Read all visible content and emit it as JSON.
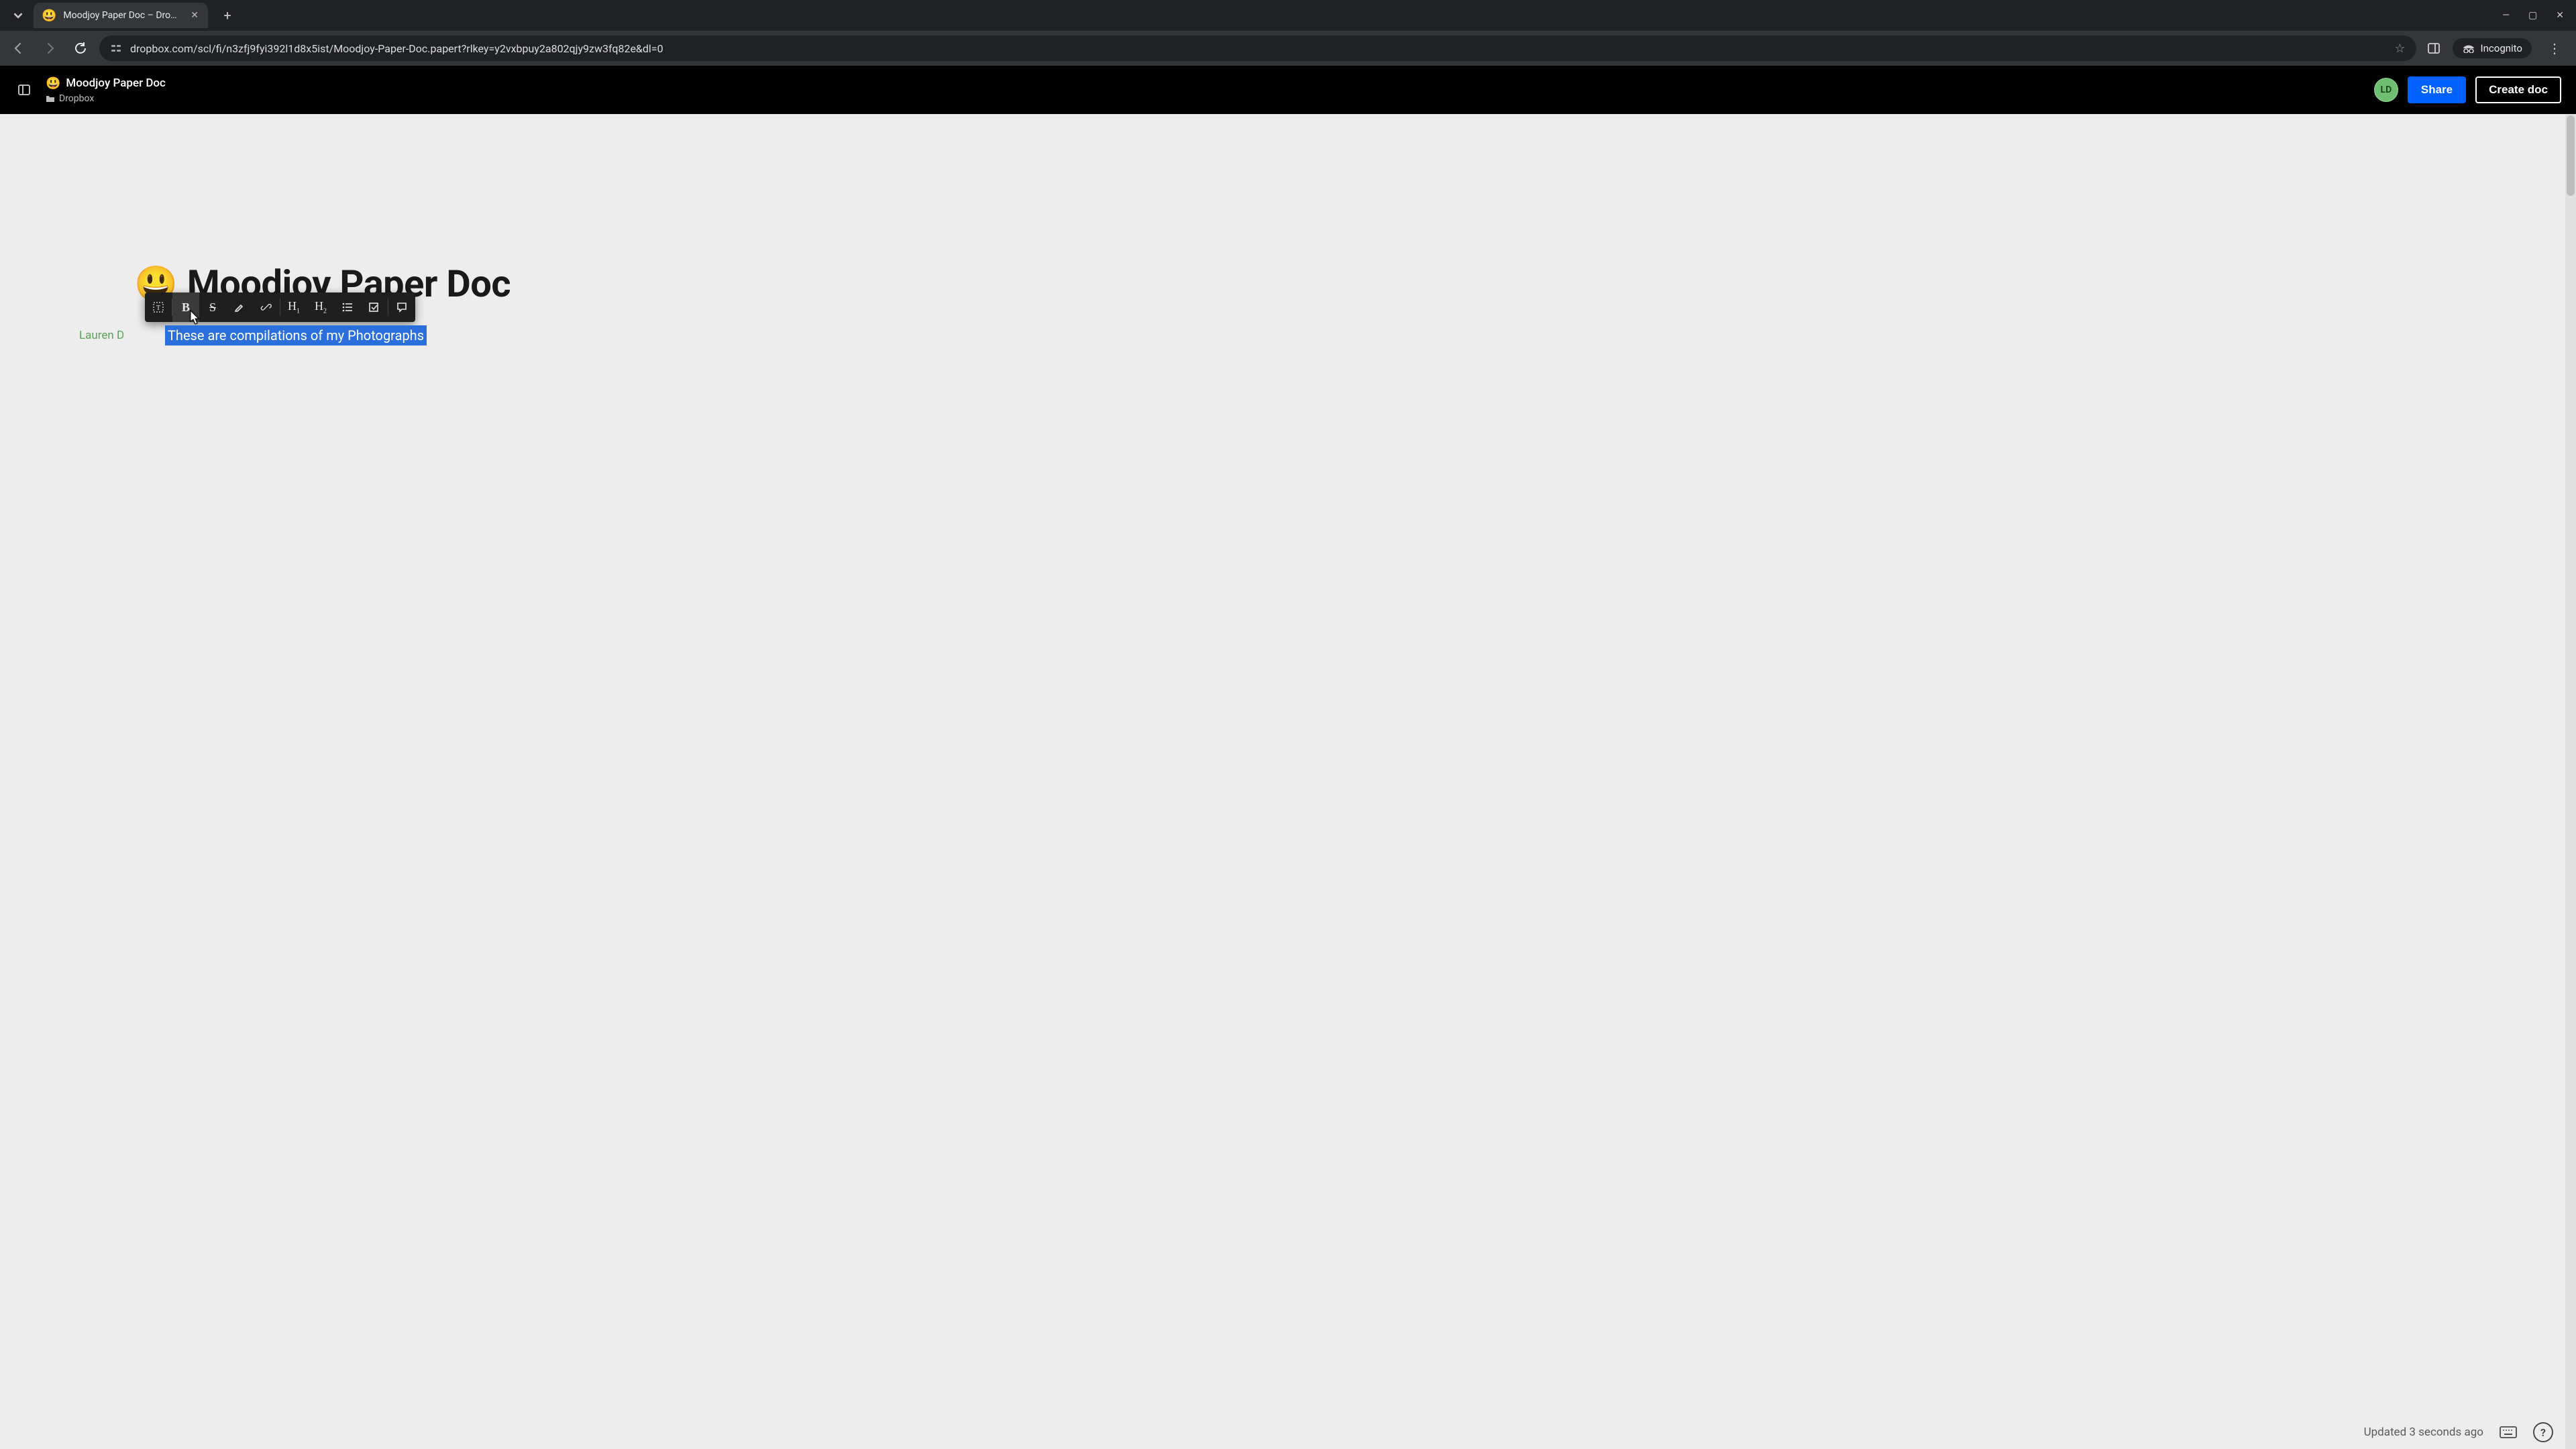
{
  "browser": {
    "tab": {
      "favicon": "😃",
      "title": "Moodjoy Paper Doc – Dropbox"
    },
    "url": "dropbox.com/scl/fi/n3zfj9fyi392l1d8x5ist/Moodjoy-Paper-Doc.papert?rlkey=y2vxbpuy2a802qjy9zw3fq82e&dl=0",
    "incognito_label": "Incognito"
  },
  "header": {
    "emoji": "😃",
    "title": "Moodjoy Paper Doc",
    "breadcrumb": "Dropbox",
    "avatar": "LD",
    "share_label": "Share",
    "create_label": "Create doc"
  },
  "document": {
    "emoji": "😃",
    "title": "Moodjoy Paper Doc",
    "author": "Lauren D",
    "selected_text": "These are compilations of my Photographs"
  },
  "toolbar": {
    "items": [
      "text-style",
      "bold",
      "strikethrough",
      "highlight",
      "link",
      "h1",
      "h2",
      "bullet-list",
      "checklist",
      "comment"
    ]
  },
  "footer": {
    "updated": "Updated 3 seconds ago"
  }
}
